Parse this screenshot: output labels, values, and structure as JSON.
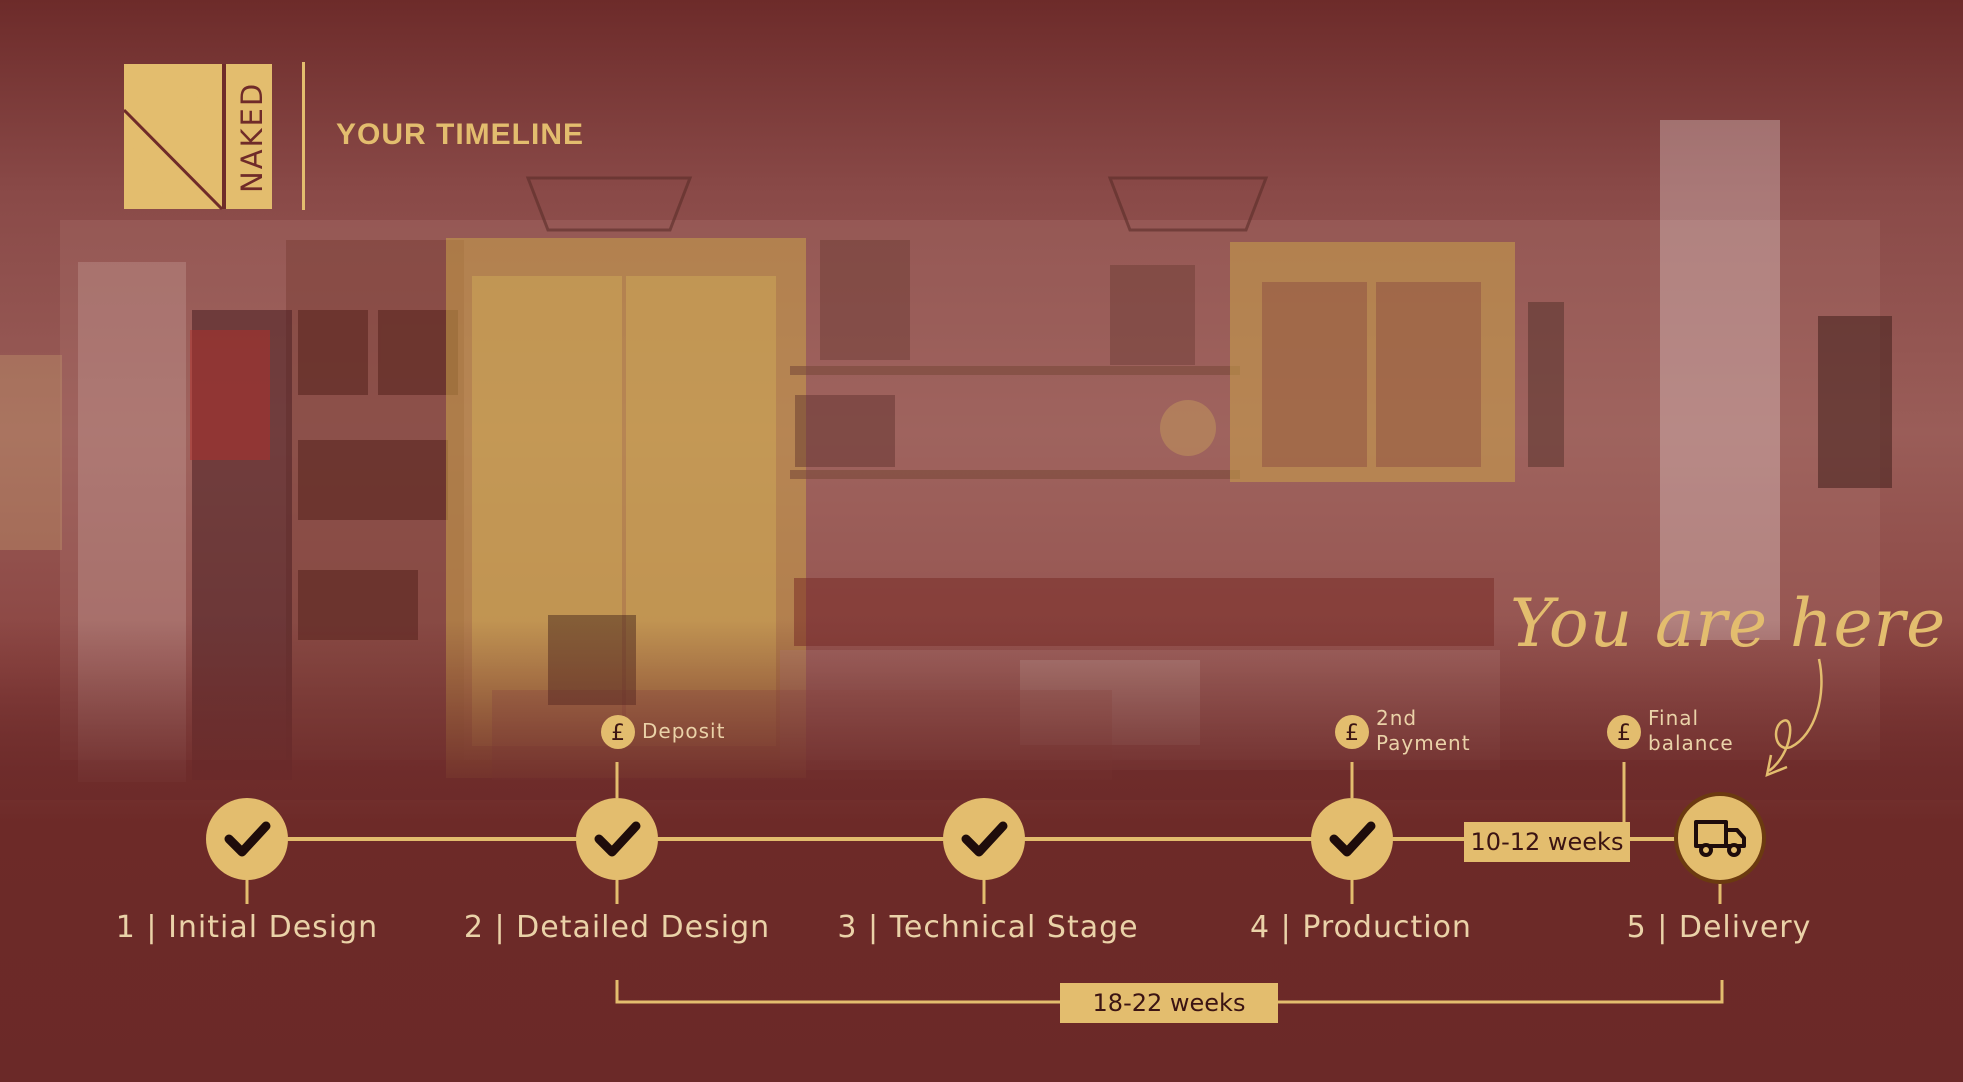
{
  "brand": {
    "logo_letter": "N",
    "logo_word": "NAKED"
  },
  "header": {
    "title": "YOUR TIMELINE"
  },
  "banner": {
    "you_are_here": "You are here"
  },
  "payments": {
    "deposit": "Deposit",
    "second_line1": "2nd",
    "second_line2": "Payment",
    "final_line1": "Final",
    "final_line2": "balance",
    "icon": "pound-icon"
  },
  "stages": [
    {
      "label": "1 | Initial Design",
      "status": "complete"
    },
    {
      "label": "2 | Detailed Design",
      "status": "complete"
    },
    {
      "label": "3 | Technical Stage",
      "status": "complete"
    },
    {
      "label": "4 | Production",
      "status": "complete"
    },
    {
      "label": "5 | Delivery",
      "status": "current"
    }
  ],
  "durations": {
    "production_to_delivery": "10-12 weeks",
    "overall": "18-22 weeks"
  },
  "colors": {
    "background": "#6d2b2a",
    "accent": "#e3bd6e",
    "text": "#ead2a8",
    "dark": "#3b1413"
  }
}
